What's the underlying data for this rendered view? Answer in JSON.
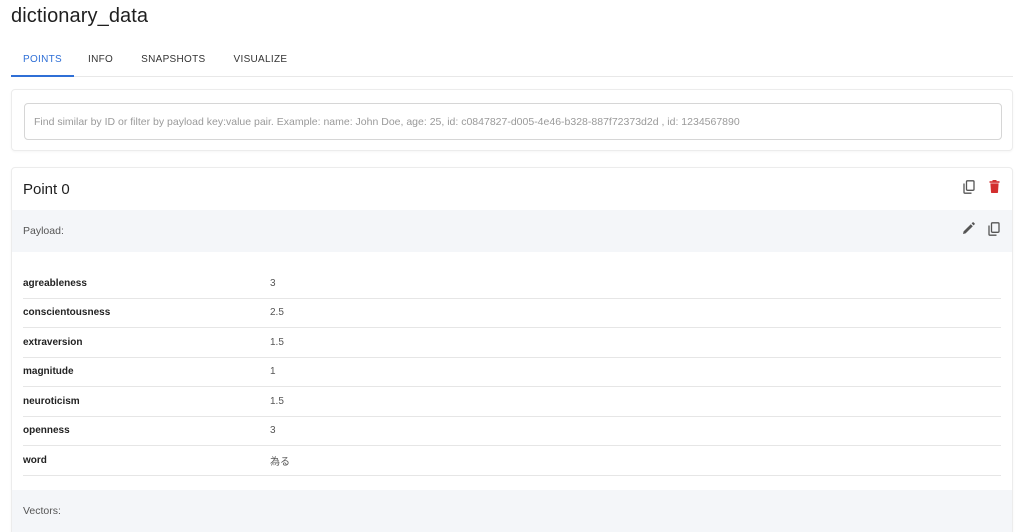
{
  "page": {
    "title": "dictionary_data"
  },
  "tabs": [
    {
      "label": "POINTS",
      "active": true
    },
    {
      "label": "INFO",
      "active": false
    },
    {
      "label": "SNAPSHOTS",
      "active": false
    },
    {
      "label": "VISUALIZE",
      "active": false
    }
  ],
  "search": {
    "value": "",
    "placeholder": "Find similar by ID or filter by payload key:value pair. Example: name: John Doe, age: 25, id: c0847827-d005-4e46-b328-887f72373d2d , id: 1234567890"
  },
  "point": {
    "title": "Point 0",
    "actions": [
      {
        "icon": "copy-icon"
      },
      {
        "icon": "delete-icon",
        "color": "#d32f2f"
      }
    ],
    "payload": {
      "label": "Payload:",
      "actions": [
        {
          "icon": "edit-icon"
        },
        {
          "icon": "copy-icon"
        }
      ],
      "rows": [
        {
          "key": "agreableness",
          "value": "3"
        },
        {
          "key": "conscientousness",
          "value": "2.5"
        },
        {
          "key": "extraversion",
          "value": "1.5"
        },
        {
          "key": "magnitude",
          "value": "1"
        },
        {
          "key": "neuroticism",
          "value": "1.5"
        },
        {
          "key": "openness",
          "value": "3"
        },
        {
          "key": "word",
          "value": "為る"
        }
      ]
    },
    "vectors": {
      "label": "Vectors:"
    }
  },
  "colors": {
    "accent": "#2f6fd6",
    "danger": "#d32f2f",
    "section_bg": "#f4f6f9"
  }
}
